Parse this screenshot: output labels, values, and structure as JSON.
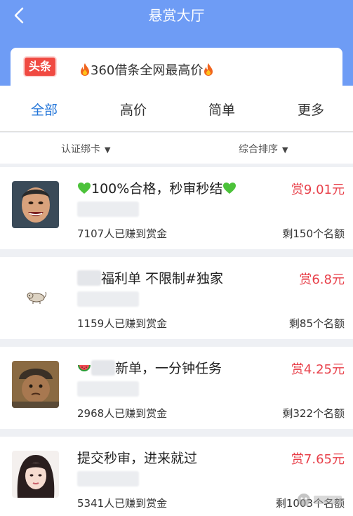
{
  "header": {
    "title": "悬赏大厅"
  },
  "banner": {
    "badge": "头条",
    "text": "360借条全网最高价"
  },
  "tabs": [
    {
      "label": "全部",
      "active": true
    },
    {
      "label": "高价",
      "active": false
    },
    {
      "label": "简单",
      "active": false
    },
    {
      "label": "更多",
      "active": false
    }
  ],
  "filters": {
    "verify": "认证绑卡",
    "sort": "综合排序",
    "arrow": "▼"
  },
  "tasks": [
    {
      "title": "100%合格，秒审秒结",
      "reward": "赏9.01元",
      "earned": "7107人已赚到赏金",
      "remaining": "剩150个名额"
    },
    {
      "title": "福利单 不限制#独家",
      "reward": "赏6.8元",
      "earned": "1159人已赚到赏金",
      "remaining": "剩85个名额"
    },
    {
      "title": "新单，一分钟任务",
      "reward": "赏4.25元",
      "earned": "2968人已赚到赏金",
      "remaining": "剩322个名额"
    },
    {
      "title": "提交秒审，进来就过",
      "reward": "赏7.65元",
      "earned": "5341人已赚到赏金",
      "remaining": "剩1003个名额"
    }
  ],
  "colors": {
    "header": "#6e9cf5",
    "active_tab": "#1f73d8",
    "reward": "#e8404a",
    "badge": "#f04a42"
  },
  "icons": [
    "back-arrow-icon",
    "fire-icon",
    "green-heart-icon",
    "watermelon-icon",
    "dropdown-arrow-icon"
  ]
}
